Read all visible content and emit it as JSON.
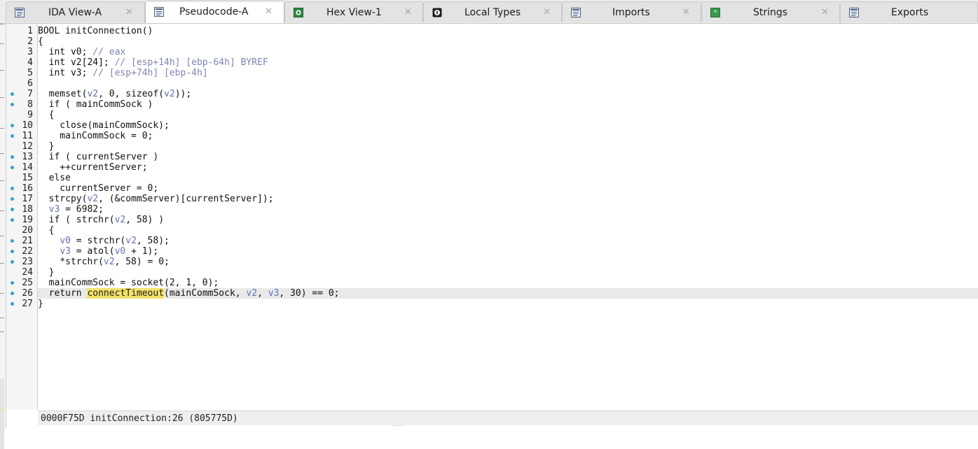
{
  "tabs": [
    {
      "label": "IDA View-A",
      "icon": "ida-view-icon",
      "active": false
    },
    {
      "label": "Pseudocode-A",
      "icon": "pseudocode-icon",
      "active": true
    },
    {
      "label": "Hex View-1",
      "icon": "hex-view-icon",
      "active": false
    },
    {
      "label": "Local Types",
      "icon": "local-types-icon",
      "active": false
    },
    {
      "label": "Imports",
      "icon": "imports-icon",
      "active": false
    },
    {
      "label": "Strings",
      "icon": "strings-icon",
      "active": false
    },
    {
      "label": "Exports",
      "icon": "exports-icon",
      "active": false
    }
  ],
  "close_glyph": "✕",
  "breakpoint_dot_color": "#3a9fc7",
  "highlight_color": "#f2e26a",
  "lines": [
    {
      "n": "1",
      "dot": false
    },
    {
      "n": "2",
      "dot": false
    },
    {
      "n": "3",
      "dot": false
    },
    {
      "n": "4",
      "dot": false
    },
    {
      "n": "5",
      "dot": false
    },
    {
      "n": "6",
      "dot": false
    },
    {
      "n": "7",
      "dot": true
    },
    {
      "n": "8",
      "dot": true
    },
    {
      "n": "9",
      "dot": false
    },
    {
      "n": "10",
      "dot": true
    },
    {
      "n": "11",
      "dot": true
    },
    {
      "n": "12",
      "dot": false
    },
    {
      "n": "13",
      "dot": true
    },
    {
      "n": "14",
      "dot": true
    },
    {
      "n": "15",
      "dot": false
    },
    {
      "n": "16",
      "dot": true
    },
    {
      "n": "17",
      "dot": true
    },
    {
      "n": "18",
      "dot": true
    },
    {
      "n": "19",
      "dot": true
    },
    {
      "n": "20",
      "dot": false
    },
    {
      "n": "21",
      "dot": true
    },
    {
      "n": "22",
      "dot": true
    },
    {
      "n": "23",
      "dot": true
    },
    {
      "n": "24",
      "dot": false
    },
    {
      "n": "25",
      "dot": true
    },
    {
      "n": "26",
      "dot": true
    },
    {
      "n": "27",
      "dot": true
    }
  ],
  "code": [
    [
      {
        "t": "BOOL initConnection()",
        "c": "kw"
      }
    ],
    [
      {
        "t": "{",
        "c": "kw"
      }
    ],
    [
      {
        "t": "  int v0; ",
        "c": "kw"
      },
      {
        "t": "// eax",
        "c": "cmt"
      }
    ],
    [
      {
        "t": "  int v2[24]; ",
        "c": "kw"
      },
      {
        "t": "// [esp+14h] [ebp-64h] BYREF",
        "c": "cmt"
      }
    ],
    [
      {
        "t": "  int v3; ",
        "c": "kw"
      },
      {
        "t": "// [esp+74h] [ebp-4h]",
        "c": "cmt"
      }
    ],
    [
      {
        "t": "",
        "c": "kw"
      }
    ],
    [
      {
        "t": "  memset(",
        "c": "kw"
      },
      {
        "t": "v2",
        "c": "var"
      },
      {
        "t": ", 0, sizeof(",
        "c": "kw"
      },
      {
        "t": "v2",
        "c": "var"
      },
      {
        "t": "));",
        "c": "kw"
      }
    ],
    [
      {
        "t": "  if ( mainCommSock )",
        "c": "kw"
      }
    ],
    [
      {
        "t": "  {",
        "c": "kw"
      }
    ],
    [
      {
        "t": "    close(mainCommSock);",
        "c": "kw"
      }
    ],
    [
      {
        "t": "    mainCommSock = 0;",
        "c": "kw"
      }
    ],
    [
      {
        "t": "  }",
        "c": "kw"
      }
    ],
    [
      {
        "t": "  if ( currentServer )",
        "c": "kw"
      }
    ],
    [
      {
        "t": "    ++currentServer;",
        "c": "kw"
      }
    ],
    [
      {
        "t": "  else",
        "c": "kw"
      }
    ],
    [
      {
        "t": "    currentServer = 0;",
        "c": "kw"
      }
    ],
    [
      {
        "t": "  strcpy(",
        "c": "kw"
      },
      {
        "t": "v2",
        "c": "var"
      },
      {
        "t": ", (&commServer)[currentServer]);",
        "c": "kw"
      }
    ],
    [
      {
        "t": "  ",
        "c": "kw"
      },
      {
        "t": "v3",
        "c": "var"
      },
      {
        "t": " = 6982;",
        "c": "kw"
      }
    ],
    [
      {
        "t": "  if ( strchr(",
        "c": "kw"
      },
      {
        "t": "v2",
        "c": "var"
      },
      {
        "t": ", 58) )",
        "c": "kw"
      }
    ],
    [
      {
        "t": "  {",
        "c": "kw"
      }
    ],
    [
      {
        "t": "    ",
        "c": "kw"
      },
      {
        "t": "v0",
        "c": "var"
      },
      {
        "t": " = strchr(",
        "c": "kw"
      },
      {
        "t": "v2",
        "c": "var"
      },
      {
        "t": ", 58);",
        "c": "kw"
      }
    ],
    [
      {
        "t": "    ",
        "c": "kw"
      },
      {
        "t": "v3",
        "c": "var"
      },
      {
        "t": " = atol(",
        "c": "kw"
      },
      {
        "t": "v0",
        "c": "var"
      },
      {
        "t": " + 1);",
        "c": "kw"
      }
    ],
    [
      {
        "t": "    *strchr(",
        "c": "kw"
      },
      {
        "t": "v2",
        "c": "var"
      },
      {
        "t": ", 58) = 0;",
        "c": "kw"
      }
    ],
    [
      {
        "t": "  }",
        "c": "kw"
      }
    ],
    [
      {
        "t": "  mainCommSock = socket(2, 1, 0);",
        "c": "kw"
      }
    ],
    [
      {
        "t": "  return ",
        "c": "kw"
      },
      {
        "t": "connectTimeout",
        "c": "hi"
      },
      {
        "t": "(mainCommSock, ",
        "c": "kw"
      },
      {
        "t": "v2",
        "c": "var"
      },
      {
        "t": ", ",
        "c": "kw"
      },
      {
        "t": "v3",
        "c": "var"
      },
      {
        "t": ", 30) == 0;",
        "c": "kw"
      }
    ],
    [
      {
        "t": "}",
        "c": "kw"
      }
    ]
  ],
  "current_line_index": 25,
  "status": "0000F75D initConnection:26 (805775D)"
}
